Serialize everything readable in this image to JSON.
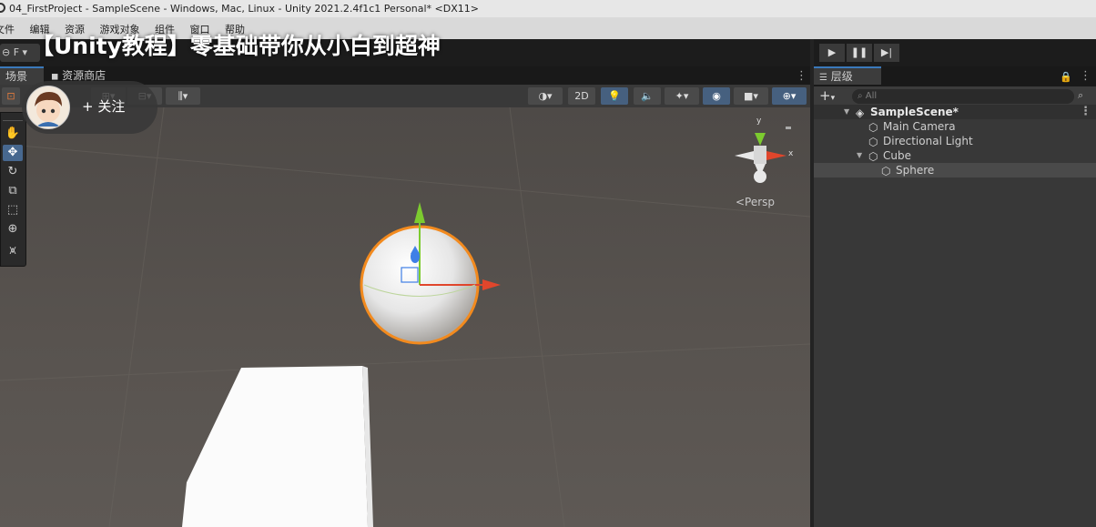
{
  "window": {
    "title": "04_FirstProject - SampleScene - Windows, Mac, Linux - Unity 2021.2.4f1c1 Personal* <DX11>"
  },
  "menu": [
    "文件",
    "编辑",
    "资源",
    "游戏对象",
    "组件",
    "窗口",
    "帮助"
  ],
  "banner": {
    "text": "【Unity教程】零基础带你从小白到超神"
  },
  "follow": {
    "label": "+ 关注"
  },
  "toolbar": {
    "layer_value": "F"
  },
  "scene_tabs": {
    "scene": "场景",
    "asset_store": "资源商店"
  },
  "scene_toolbar": {
    "mode_2d": "2D"
  },
  "viewport": {
    "persp_label": "<Persp",
    "axis_y": "y",
    "axis_x": "x"
  },
  "hierarchy": {
    "tab_label": "层级",
    "search_placeholder": "All",
    "items": [
      {
        "label": "SampleScene*",
        "type": "scene"
      },
      {
        "label": "Main Camera",
        "type": "gameobject"
      },
      {
        "label": "Directional Light",
        "type": "gameobject"
      },
      {
        "label": "Cube",
        "type": "gameobject"
      },
      {
        "label": "Sphere",
        "type": "gameobject"
      }
    ]
  },
  "colors": {
    "accent_blue": "#3a79bb",
    "selection_orange": "#f28a1e",
    "x_axis": "#e0462c",
    "y_axis": "#7ccb2f",
    "z_axis": "#3f7fe6"
  }
}
